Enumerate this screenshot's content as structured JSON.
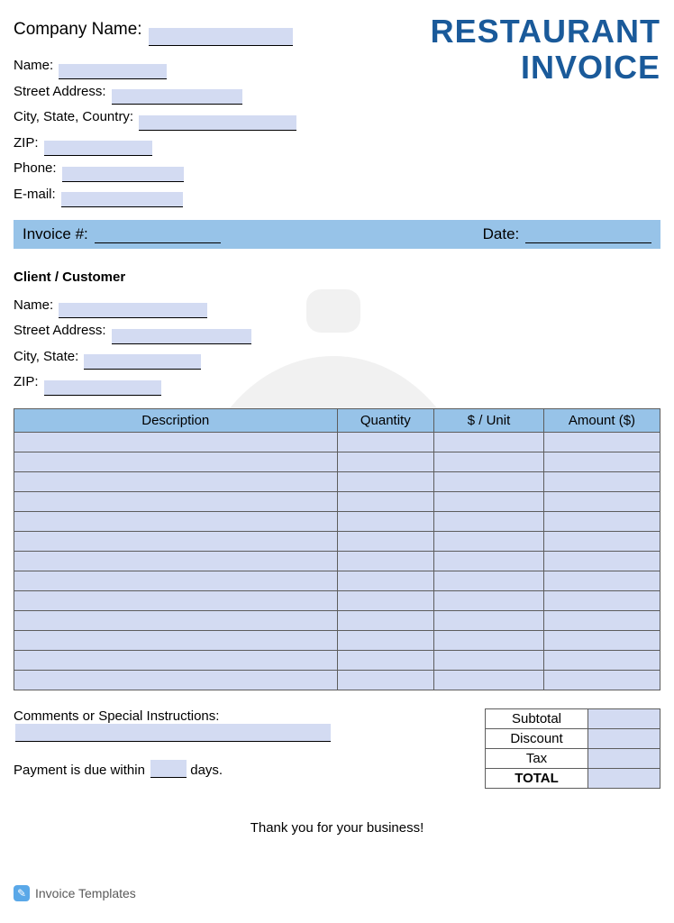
{
  "company": {
    "company_name_label": "Company Name:",
    "name_label": "Name:",
    "street_label": "Street Address:",
    "citystatecountry_label": "City, State, Country:",
    "zip_label": "ZIP:",
    "phone_label": "Phone:",
    "email_label": "E-mail:"
  },
  "title": {
    "line1": "RESTAURANT",
    "line2": "INVOICE"
  },
  "invoice_bar": {
    "number_label": "Invoice #:",
    "date_label": "Date:"
  },
  "client": {
    "header": "Client / Customer",
    "name_label": "Name:",
    "street_label": "Street Address:",
    "citystate_label": "City, State:",
    "zip_label": "ZIP:"
  },
  "table": {
    "headers": {
      "description": "Description",
      "quantity": "Quantity",
      "unit": "$ / Unit",
      "amount": "Amount ($)"
    },
    "row_count": 13
  },
  "comments": {
    "label": "Comments or Special Instructions:"
  },
  "payment": {
    "prefix": "Payment is due within",
    "suffix": "days."
  },
  "totals": {
    "subtotal": "Subtotal",
    "discount": "Discount",
    "tax": "Tax",
    "total": "TOTAL"
  },
  "thanks": "Thank you for your business!",
  "footer": "Invoice Templates"
}
